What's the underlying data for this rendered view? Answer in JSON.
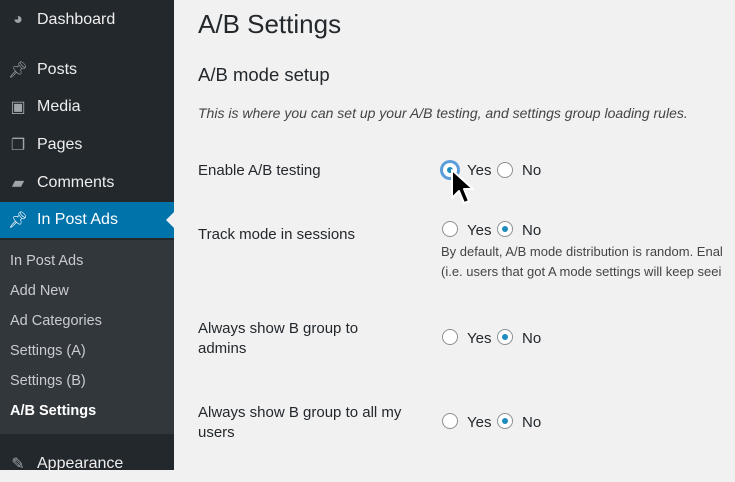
{
  "sidebar": {
    "items": [
      {
        "label": "Dashboard",
        "icon": "dashboard-icon"
      },
      {
        "label": "Posts",
        "icon": "pin-icon"
      },
      {
        "label": "Media",
        "icon": "media-icon"
      },
      {
        "label": "Pages",
        "icon": "pages-icon"
      },
      {
        "label": "Comments",
        "icon": "comment-icon"
      },
      {
        "label": "In Post Ads",
        "icon": "pin-icon",
        "active": true
      },
      {
        "label": "Appearance",
        "icon": "paintbrush-icon"
      }
    ],
    "submenu": [
      {
        "label": "In Post Ads"
      },
      {
        "label": "Add New"
      },
      {
        "label": "Ad Categories"
      },
      {
        "label": "Settings (A)"
      },
      {
        "label": "Settings (B)"
      },
      {
        "label": "A/B Settings",
        "current": true
      }
    ]
  },
  "main": {
    "title": "A/B Settings",
    "section_title": "A/B mode setup",
    "description": "This is where you can set up your A/B testing, and settings group loading rules.",
    "rows": [
      {
        "label": "Enable A/B testing",
        "value": "Yes"
      },
      {
        "label": "Track mode in sessions",
        "value": "No",
        "help_line1": "By default, A/B mode distribution is random. Enal",
        "help_line2": "(i.e. users that got A mode settings will keep seei"
      },
      {
        "label": "Always show B group to admins",
        "value": "No"
      },
      {
        "label": "Always show B group to all my users",
        "value": "No"
      }
    ],
    "yes_label": "Yes",
    "no_label": "No"
  },
  "colors": {
    "sidebar_bg": "#23282d",
    "submenu_bg": "#32373c",
    "active_bg": "#0073aa",
    "radio_dot": "#1e8cbe"
  }
}
